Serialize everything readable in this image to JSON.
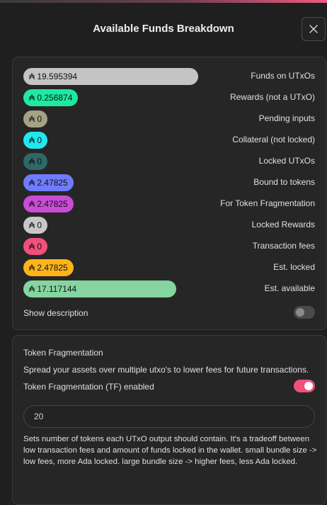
{
  "dialog": {
    "title": "Available Funds Breakdown",
    "close_icon": "close-icon"
  },
  "funds": [
    {
      "amount": "₳ 19.595394",
      "label": "Funds on UTxOs",
      "color": "#c4c4c4",
      "fraction": 1.0
    },
    {
      "amount": "₳ 0.256874",
      "label": "Rewards (not a UTxO)",
      "color": "#1de9a0",
      "fraction": 0.0
    },
    {
      "amount": "₳ 0",
      "label": "Pending inputs",
      "color": "#a5a386",
      "fraction": 0.0
    },
    {
      "amount": "₳ 0",
      "label": "Collateral (not locked)",
      "color": "#20e8ee",
      "fraction": 0.0
    },
    {
      "amount": "₳ 0",
      "label": "Locked UTxOs",
      "color": "#2e6868",
      "fraction": 0.0
    },
    {
      "amount": "₳ 2.47825",
      "label": "Bound to tokens",
      "color": "#6f7cff",
      "fraction": 0.0
    },
    {
      "amount": "₳ 2.47825",
      "label": "For Token Fragmentation",
      "color": "#c94bd6",
      "fraction": 0.0
    },
    {
      "amount": "₳ 0",
      "label": "Locked Rewards",
      "color": "#c8c8c8",
      "fraction": 0.0
    },
    {
      "amount": "₳ 0",
      "label": "Transaction fees",
      "color": "#f0507a",
      "fraction": 0.0
    },
    {
      "amount": "₳ 2.47825",
      "label": "Est. locked",
      "color": "#ffb31a",
      "fraction": 0.0
    },
    {
      "amount": "₳ 17.117144",
      "label": "Est. available",
      "color": "#86d4a0",
      "fraction": 0.874
    }
  ],
  "show_description": {
    "label": "Show description",
    "enabled": false
  },
  "token_fragmentation": {
    "heading": "Token Fragmentation",
    "description": "Spread your assets over multiple utxo's to lower fees for future transactions.",
    "toggle_label": "Token Fragmentation (TF) enabled",
    "enabled": true,
    "bundle_size": "20",
    "help_text": "Sets number of tokens each UTxO output should contain. It's a tradeoff between low transaction fees and amount of funds locked in the wallet. small bundle size -> low fees, more Ada locked. large bundle size -> higher fees, less Ada locked."
  }
}
